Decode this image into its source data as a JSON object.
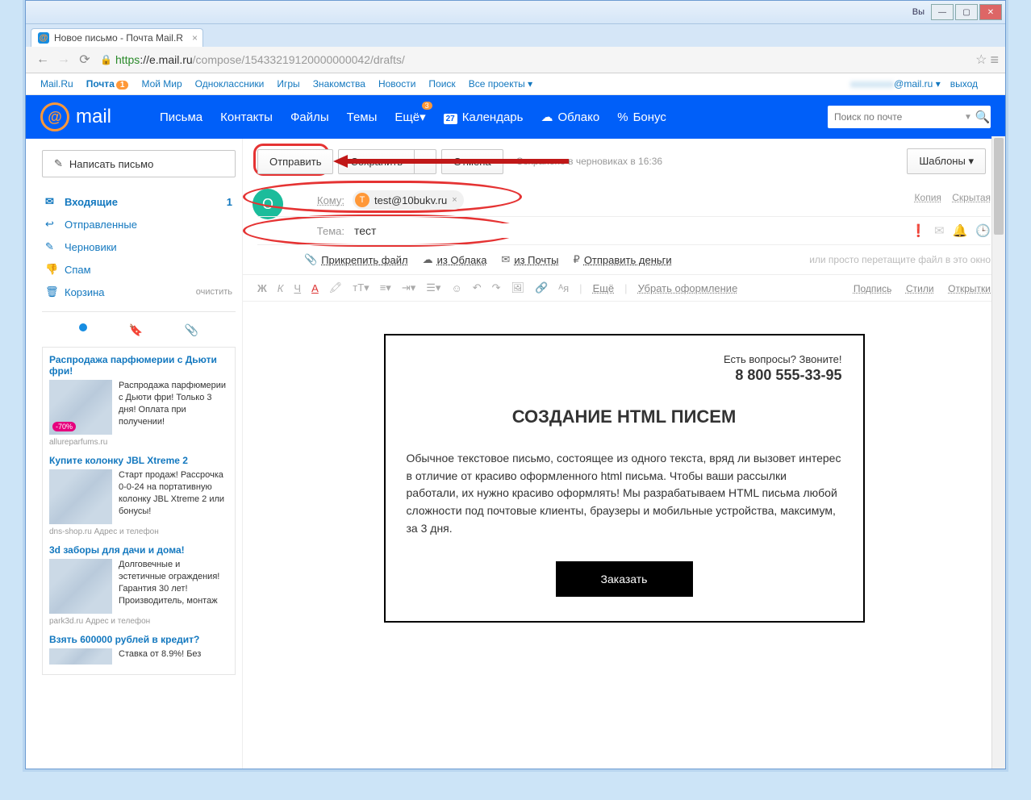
{
  "window": {
    "user": "Вы",
    "min": "—",
    "max": "▢",
    "close": "✕"
  },
  "tab": {
    "title": "Новое письмо - Почта Mail.R",
    "close": "×"
  },
  "address": {
    "https": "https",
    "host": "://e.mail.ru",
    "path": "/compose/15433219120000000042/drafts/"
  },
  "portal": {
    "links": [
      "Mail.Ru",
      "Почта",
      "Мой Мир",
      "Одноклассники",
      "Игры",
      "Знакомства",
      "Новости",
      "Поиск",
      "Все проекты"
    ],
    "badge": "1",
    "dd": "▾",
    "user": "@mail.ru",
    "user_dd": "▾",
    "exit": "выход"
  },
  "nav": {
    "logo": "mail",
    "items": [
      "Письма",
      "Контакты",
      "Файлы",
      "Темы",
      "Ещё"
    ],
    "more_badge": "3",
    "more_dd": "▾",
    "cal": "Календарь",
    "cal_day": "27",
    "cloud": "Облако",
    "bonus": "Бонус",
    "search_ph": "Поиск по почте"
  },
  "sidebar": {
    "compose": "Написать письмо",
    "folders": [
      {
        "icon": "✉",
        "label": "Входящие",
        "count": "1"
      },
      {
        "icon": "↩",
        "label": "Отправленные"
      },
      {
        "icon": "✎",
        "label": "Черновики"
      },
      {
        "icon": "👎",
        "label": "Спам"
      },
      {
        "icon": "🗑",
        "label": "Корзина",
        "clear": "очистить"
      }
    ],
    "ads": [
      {
        "title": "Распродажа парфюмерии с Дьюти фри!",
        "text": "Распродажа парфюмерии с Дьюти фри! Только 3 дня! Оплата при получении!",
        "domain": "allureparfums.ru",
        "sale": "-70%"
      },
      {
        "title": "Купите колонку JBL Xtreme 2",
        "text": "Старт продаж! Рассрочка 0-0-24 на портативную колонку JBL Xtreme 2 или бонусы!",
        "domain": "dns-shop.ru   Адрес и телефон"
      },
      {
        "title": "3d заборы для дачи и дома!",
        "text": "Долговечные и эстетичные ограждения! Гарантия 30 лет! Производитель, монтаж",
        "domain": "park3d.ru   Адрес и телефон"
      },
      {
        "title": "Взять 600000 рублей в кредит?",
        "text": "Ставка от 8.9%! Без",
        "domain": ""
      }
    ]
  },
  "toolbar": {
    "send": "Отправить",
    "save": "Сохранить",
    "save_dd": "▼",
    "cancel": "Отмена",
    "status": "Сохранено в черновиках в 16:36",
    "templates": "Шаблоны",
    "templates_dd": "▾"
  },
  "fields": {
    "avatar": "О",
    "to_label": "Кому:",
    "to_chip_letter": "T",
    "to_chip": "test@10bukv.ru",
    "chip_x": "×",
    "copy": "Копия",
    "bcc": "Скрытая",
    "subject_label": "Тема:",
    "subject": "тест"
  },
  "attach": {
    "file": "Прикрепить файл",
    "cloud": "из Облака",
    "mail": "из Почты",
    "money": "Отправить деньги",
    "hint": "или просто перетащите файл в это окно"
  },
  "format": {
    "more": "Ещё",
    "clear": "Убрать оформление",
    "sign": "Подпись",
    "styles": "Стили",
    "cards": "Открытки"
  },
  "letter": {
    "question": "Есть вопросы? Звоните!",
    "phone": "8 800 555-33-95",
    "title": "СОЗДАНИЕ HTML ПИСЕМ",
    "body": "Обычное текстовое письмо, состоящее из одного текста, вряд ли вызовет интерес в отличие от красиво оформленного html письма. Чтобы ваши рассылки работали, их нужно красиво оформлять! Мы разрабатываем HTML письма любой сложности под почтовые клиенты, браузеры и мобильные устройства, максимум, за 3 дня.",
    "cta": "Заказать"
  }
}
